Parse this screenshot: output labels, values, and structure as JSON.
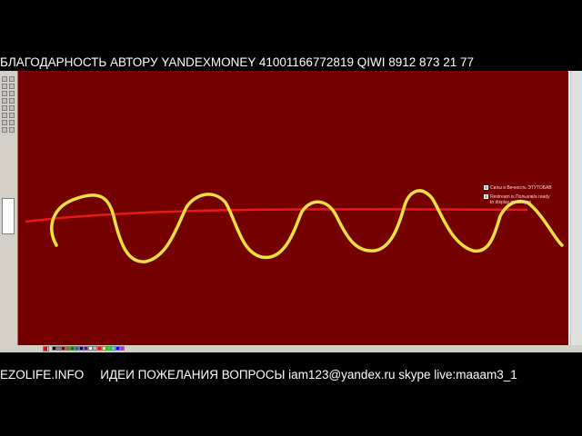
{
  "banner_top": "БЛАГОДАРНОСТЬ АВТОРУ YANDEXMONEY 41001166772819   QIWI 8912 873 21 77",
  "banner_bottom": {
    "site": "EZOLIFE.INFO",
    "ideas": "ИДЕИ ПОЖЕЛАНИЯ ВОПРОСЫ iam123@yandex.ru  skype live:maaam3_1"
  },
  "canvas": {
    "background_color": "#740000",
    "curve_color": "#f0e040",
    "line_color": "#e81818",
    "labels": [
      "Силы в Вечность ЭТУТОБАВ",
      "Restream is Пользов/а ready to display messages"
    ]
  },
  "palette": {
    "primary": "#ff0000",
    "secondary": "#ffffff",
    "colors": [
      "#000000",
      "#808080",
      "#800000",
      "#808000",
      "#008000",
      "#008080",
      "#000080",
      "#800080",
      "#ffffff",
      "#c0c0c0",
      "#ff0000",
      "#ffff00",
      "#00ff00",
      "#00ffff",
      "#0000ff",
      "#ff00ff"
    ]
  },
  "tools": [
    "free-select",
    "select",
    "eraser",
    "fill",
    "picker",
    "magnifier",
    "pencil",
    "brush",
    "airbrush",
    "text",
    "line",
    "curve",
    "rectangle",
    "polygon",
    "ellipse",
    "rounded-rect"
  ]
}
